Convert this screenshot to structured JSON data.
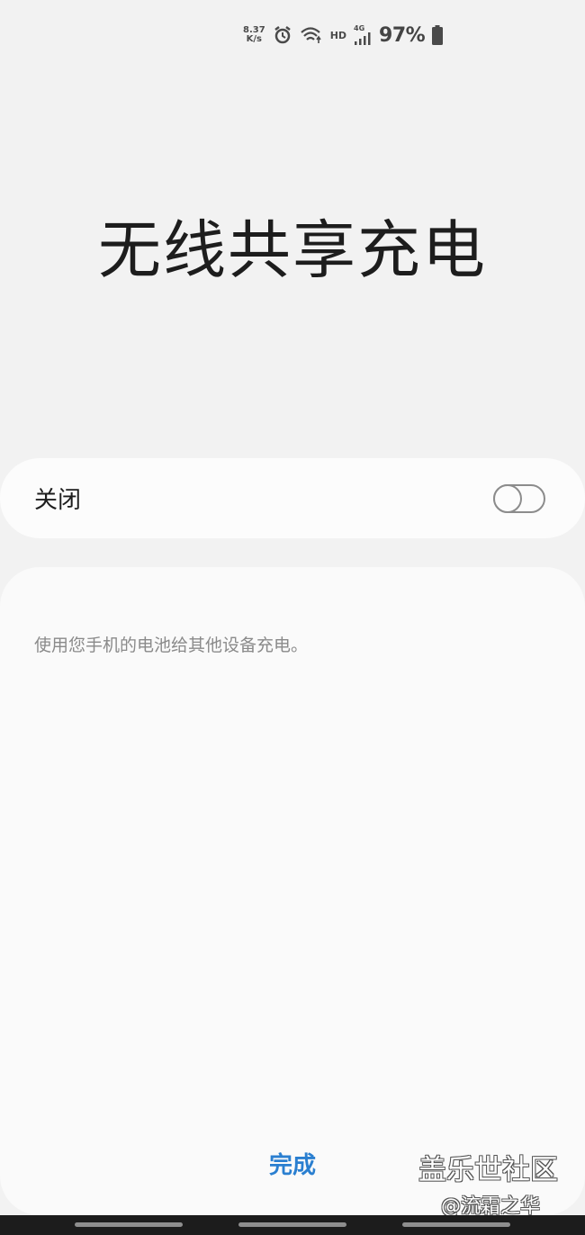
{
  "status_bar": {
    "speed_value": "8.37",
    "speed_unit": "K/s",
    "hd": "HD",
    "network": "4G",
    "battery": "97%"
  },
  "title": "无线共享充电",
  "toggle": {
    "label": "关闭",
    "state": "off"
  },
  "description": "使用您手机的电池给其他设备充电。",
  "done_label": "完成",
  "watermark": {
    "line1": "盖乐世社区",
    "line2": "@流霜之华"
  },
  "colors": {
    "accent": "#2a7fd0",
    "background": "#f2f2f2",
    "card": "#fcfcfc"
  }
}
